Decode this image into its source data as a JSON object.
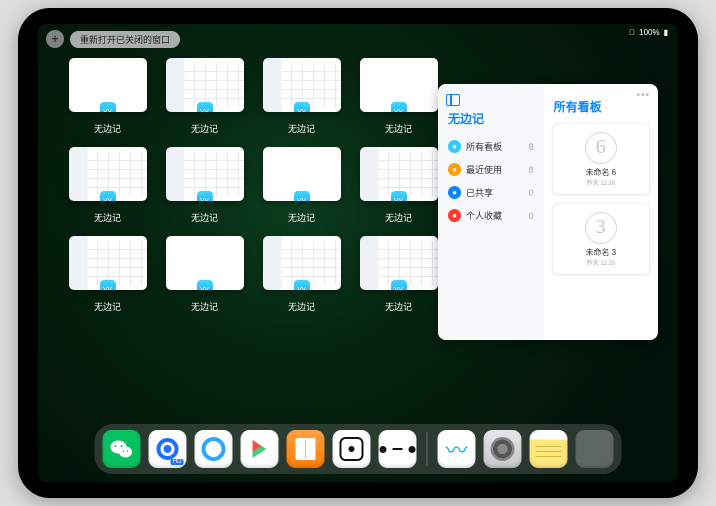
{
  "status": {
    "battery": "100%",
    "wifi": "wifi"
  },
  "topbar": {
    "plus": "+",
    "reopen_label": "重新打开已关闭的窗口"
  },
  "app_name": "无边记",
  "windows": [
    {
      "label": "无边记",
      "style": "blank"
    },
    {
      "label": "无边记",
      "style": "detailed"
    },
    {
      "label": "无边记",
      "style": "detailed"
    },
    {
      "label": "无边记",
      "style": "blank"
    },
    {
      "label": "无边记",
      "style": "detailed"
    },
    {
      "label": "无边记",
      "style": "detailed"
    },
    {
      "label": "无边记",
      "style": "blank"
    },
    {
      "label": "无边记",
      "style": "detailed"
    },
    {
      "label": "无边记",
      "style": "detailed"
    },
    {
      "label": "无边记",
      "style": "blank"
    },
    {
      "label": "无边记",
      "style": "detailed"
    },
    {
      "label": "无边记",
      "style": "detailed"
    }
  ],
  "panel": {
    "left_title": "无边记",
    "menu": [
      {
        "label": "所有看板",
        "count": "8",
        "color": "#34c8ff"
      },
      {
        "label": "最近使用",
        "count": "8",
        "color": "#ff9f0a"
      },
      {
        "label": "已共享",
        "count": "0",
        "color": "#0a84ff"
      },
      {
        "label": "个人收藏",
        "count": "0",
        "color": "#ff3b30"
      }
    ],
    "right_title": "所有看板",
    "boards": [
      {
        "sketch": "6",
        "title": "未命名 6",
        "sub": "昨天 11:28"
      },
      {
        "sketch": "3",
        "title": "未命名 3",
        "sub": "昨天 11:25"
      }
    ]
  },
  "dock": {
    "main": [
      "wechat",
      "qq",
      "qqbrowser",
      "aqiyi",
      "books",
      "dice",
      "connect"
    ],
    "recent": [
      "freeform",
      "settings",
      "notes",
      "folder"
    ]
  }
}
